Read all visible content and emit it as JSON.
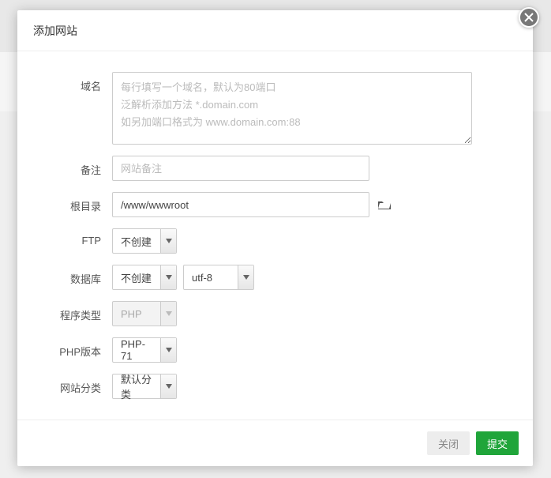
{
  "dialog": {
    "title": "添加网站"
  },
  "labels": {
    "domain": "域名",
    "note": "备注",
    "rootdir": "根目录",
    "ftp": "FTP",
    "database": "数据库",
    "programType": "程序类型",
    "phpVersion": "PHP版本",
    "siteCategory": "网站分类"
  },
  "fields": {
    "domain": {
      "value": "",
      "placeholder": "每行填写一个域名，默认为80端口\n泛解析添加方法 *.domain.com\n如另加端口格式为 www.domain.com:88"
    },
    "note": {
      "value": "",
      "placeholder": "网站备注"
    },
    "rootdir": {
      "value": "/www/wwwroot"
    },
    "ftp": {
      "selected": "不创建"
    },
    "database": {
      "selected": "不创建"
    },
    "charset": {
      "selected": "utf-8"
    },
    "programType": {
      "selected": "PHP"
    },
    "phpVersion": {
      "selected": "PHP-71"
    },
    "siteCategory": {
      "selected": "默认分类"
    }
  },
  "buttons": {
    "cancel": "关闭",
    "submit": "提交"
  }
}
